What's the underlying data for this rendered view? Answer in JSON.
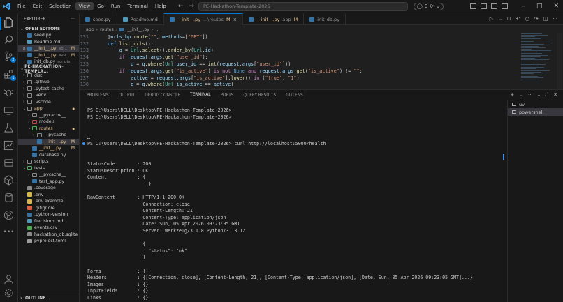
{
  "titlebar": {
    "menu": [
      "File",
      "Edit",
      "Selection",
      "View",
      "Go",
      "Run",
      "Terminal",
      "Help"
    ],
    "active_menu": "View",
    "search": "PE-Hackathon-Template-2026",
    "accounts_count": "0"
  },
  "sidebar": {
    "header": "EXPLORER",
    "open_editors_label": "OPEN EDITORS",
    "open_editors": [
      {
        "label": "seed.py",
        "desc": "",
        "status": "",
        "color": "#3572a5"
      },
      {
        "label": "Readme.md",
        "desc": "",
        "status": "",
        "color": "#519aba"
      },
      {
        "label": "__init__.py",
        "desc": "ap...",
        "status": "M",
        "color": "#3572a5",
        "selected": true,
        "close": "×"
      },
      {
        "label": "__init__.py",
        "desc": "app",
        "status": "M",
        "color": "#3572a5"
      },
      {
        "label": "init_db.py",
        "desc": "scripts",
        "status": "",
        "color": "#3572a5"
      }
    ],
    "project_label": "PE-HACKATHON-TEMPLA...",
    "tree": [
      {
        "label": "dist",
        "indent": 1,
        "folder": true
      },
      {
        "label": ".github",
        "indent": 1,
        "folder": true
      },
      {
        "label": ".pytest_cache",
        "indent": 1,
        "folder": true
      },
      {
        "label": ".venv",
        "indent": 1,
        "folder": true
      },
      {
        "label": ".vscode",
        "indent": 1,
        "folder": true
      },
      {
        "label": "app",
        "indent": 1,
        "folder": true,
        "open": true,
        "color": "#e2c08d",
        "dot": true
      },
      {
        "label": "__pycache__",
        "indent": 2,
        "folder": true
      },
      {
        "label": "models",
        "indent": 2,
        "folder": true,
        "fcolor": "#c2453d"
      },
      {
        "label": "routes",
        "indent": 2,
        "folder": true,
        "open": true,
        "color": "#e2c08d",
        "dot": true,
        "fcolor": "#4caf50"
      },
      {
        "label": "__pycache__",
        "indent": 3,
        "folder": true
      },
      {
        "label": "__init__.py",
        "indent": 3,
        "status": "M",
        "color": "#e2c08d",
        "selected": true,
        "fcolor": "#3572a5"
      },
      {
        "label": "__init__.py",
        "indent": 2,
        "status": "M",
        "color": "#e2c08d",
        "fcolor": "#3572a5"
      },
      {
        "label": "database.py",
        "indent": 2,
        "fcolor": "#3572a5"
      },
      {
        "label": "scripts",
        "indent": 1,
        "folder": true
      },
      {
        "label": "tests",
        "indent": 1,
        "folder": true,
        "open": true,
        "fcolor": "#4caf50"
      },
      {
        "label": "__pycache__",
        "indent": 2,
        "folder": true
      },
      {
        "label": "test_app.py",
        "indent": 2,
        "fcolor": "#3572a5"
      },
      {
        "label": ".coverage",
        "indent": 1,
        "fcolor": "#8a8a8a"
      },
      {
        "label": ".env",
        "indent": 1,
        "fcolor": "#d4b84a"
      },
      {
        "label": ".env.example",
        "indent": 1,
        "fcolor": "#d4b84a"
      },
      {
        "label": ".gitignore",
        "indent": 1,
        "fcolor": "#e05d3a"
      },
      {
        "label": ".python-version",
        "indent": 1,
        "fcolor": "#3572a5"
      },
      {
        "label": "Decisions.md",
        "indent": 1,
        "fcolor": "#519aba"
      },
      {
        "label": "events.csv",
        "indent": 1,
        "fcolor": "#4caf50"
      },
      {
        "label": "hackathon_db.sqlite",
        "indent": 1,
        "fcolor": "#8a8a8a"
      },
      {
        "label": "pyproject.toml",
        "indent": 1,
        "fcolor": "#9c9c9c"
      }
    ],
    "outline_label": "OUTLINE"
  },
  "tabs": [
    {
      "label": "seed.py",
      "desc": "",
      "status": "",
      "color": "#3572a5"
    },
    {
      "label": "Readme.md",
      "desc": "",
      "status": "",
      "color": "#519aba"
    },
    {
      "label": "__init__.py",
      "desc": "...\\routes",
      "status": "M",
      "color": "#3572a5",
      "active": true
    },
    {
      "label": "__init__.py",
      "desc": "app",
      "status": "M",
      "color": "#3572a5"
    },
    {
      "label": "init_db.py",
      "desc": "",
      "status": "",
      "color": "#3572a5"
    }
  ],
  "breadcrumb": [
    "app",
    "routes",
    "__init__.py",
    "..."
  ],
  "code": [
    {
      "n": "131",
      "text": "    @urls_bp.route(\"\", methods=[\"GET\"])"
    },
    {
      "n": "132",
      "text": "    def list_urls():"
    },
    {
      "n": "133",
      "text": "        q = Url.select().order_by(Url.id)"
    },
    {
      "n": "134",
      "text": "        if request.args.get(\"user_id\"):"
    },
    {
      "n": "135",
      "text": "            q = q.where(Url.user_id == int(request.args[\"user_id\"]))"
    },
    {
      "n": "136",
      "text": "        if request.args.get(\"is_active\") is not None and request.args.get(\"is_active\") != \"\":"
    },
    {
      "n": "137",
      "text": "            active = request.args[\"is_active\"].lower() in (\"true\", \"1\")"
    },
    {
      "n": "138",
      "text": "            q = q.where(Url.is_active == active)"
    }
  ],
  "panel": {
    "tabs": [
      "PROBLEMS",
      "OUTPUT",
      "DEBUG CONSOLE",
      "TERMINAL",
      "PORTS",
      "QUERY RESULTS",
      "GITLENS"
    ],
    "active_tab": "TERMINAL",
    "terminals": [
      "uv",
      "powershell"
    ]
  },
  "terminal": [
    "",
    "PS C:\\Users\\DELL\\Desktop\\PE-Hackathon-Template-2026>",
    "PS C:\\Users\\DELL\\Desktop\\PE-Hackathon-Template-2026>",
    "",
    "",
    "",
    "PS C:\\Users\\DELL\\Desktop\\PE-Hackathon-Template-2026> curl http://localhost:5000/health",
    "",
    "",
    "StatusCode        : 200",
    "StatusDescription : OK",
    "Content           : {",
    "                      }",
    "",
    "RawContent        : HTTP/1.1 200 OK",
    "                    Connection: close",
    "                    Content-Length: 21",
    "                    Content-Type: application/json",
    "                    Date: Sun, 05 Apr 2026 09:23:05 GMT",
    "                    Server: Werkzeug/3.1.8 Python/3.13.12",
    "",
    "                    {",
    "                      \"status\": \"ok\"",
    "                    }",
    "",
    "Forms             : {}",
    "Headers           : {[Connection, close], [Content-Length, 21], [Content-Type, application/json], [Date, Sun, 05 Apr 2026 09:23:05 GMT]...}",
    "Images            : {}",
    "InputFields       : {}",
    "Links             : {}"
  ]
}
